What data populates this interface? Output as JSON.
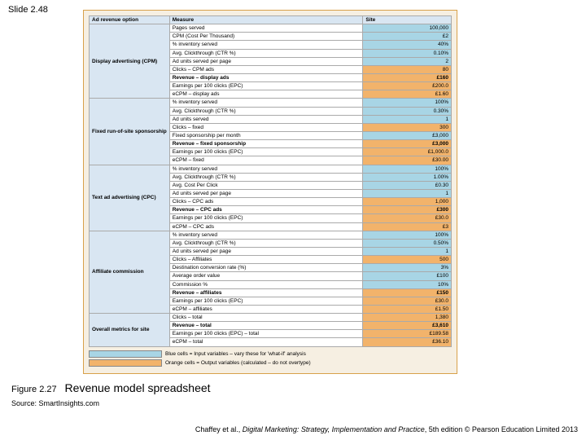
{
  "slide_number": "Slide 2.48",
  "caption": {
    "fig": "Figure 2.27",
    "title": "Revenue model spreadsheet"
  },
  "source": "Source: SmartInsights.com",
  "credit_prefix": "Chaffey et al., ",
  "credit_title": "Digital Marketing: Strategy, Implementation and Practice",
  "credit_suffix": ", 5th edition © Pearson Education Limited 2013",
  "headers": {
    "c1": "Ad revenue option",
    "c2": "Measure",
    "c3": "Site"
  },
  "legend": {
    "blue": "Blue cells = Input variables – vary these for 'what-if' analysis",
    "orange": "Orange cells = Output variables (calculated – do not overtype)"
  },
  "sections": [
    {
      "label": "Display advertising (CPM)",
      "rows": [
        {
          "m": "Pages served",
          "v": "100,000",
          "c": "blue"
        },
        {
          "m": "CPM (Cost Per Thousand)",
          "v": "£2",
          "c": "blue"
        },
        {
          "m": "% inventory served",
          "v": "40%",
          "c": "blue"
        },
        {
          "m": "Avg. Clickthrough (CTR %)",
          "v": "0.10%",
          "c": "blue"
        },
        {
          "m": "Ad units served per page",
          "v": "2",
          "c": "blue"
        },
        {
          "m": "Clicks – CPM ads",
          "v": "80",
          "c": "orange"
        },
        {
          "m": "Revenue – display ads",
          "v": "£160",
          "c": "orange",
          "bold": true
        },
        {
          "m": "Earnings per 100 clicks (EPC)",
          "v": "£200.0",
          "c": "orange"
        },
        {
          "m": "eCPM – display ads",
          "v": "£1.60",
          "c": "orange"
        }
      ]
    },
    {
      "label": "Fixed run-of-site sponsorship",
      "rows": [
        {
          "m": "% inventory served",
          "v": "100%",
          "c": "blue"
        },
        {
          "m": "Avg. Clickthrough (CTR %)",
          "v": "0.30%",
          "c": "blue"
        },
        {
          "m": "Ad units served",
          "v": "1",
          "c": "blue"
        },
        {
          "m": "Clicks – fixed",
          "v": "300",
          "c": "orange"
        },
        {
          "m": "Fixed sponsorship per month",
          "v": "£3,000",
          "c": "blue"
        },
        {
          "m": "Revenue – fixed sponsorship",
          "v": "£3,000",
          "c": "orange",
          "bold": true
        },
        {
          "m": "Earnings per 100 clicks (EPC)",
          "v": "£1,000.0",
          "c": "orange"
        },
        {
          "m": "eCPM – fixed",
          "v": "£30.00",
          "c": "orange"
        }
      ]
    },
    {
      "label": "Text ad advertising (CPC)",
      "rows": [
        {
          "m": "% inventory served",
          "v": "100%",
          "c": "blue"
        },
        {
          "m": "Avg. Clickthrough (CTR %)",
          "v": "1.00%",
          "c": "blue"
        },
        {
          "m": "Avg. Cost Per Click",
          "v": "£0.30",
          "c": "blue"
        },
        {
          "m": "Ad units served per page",
          "v": "1",
          "c": "blue"
        },
        {
          "m": "Clicks – CPC ads",
          "v": "1,000",
          "c": "orange"
        },
        {
          "m": "Revenue – CPC ads",
          "v": "£300",
          "c": "orange",
          "bold": true
        },
        {
          "m": "Earnings per 100 clicks (EPC)",
          "v": "£30.0",
          "c": "orange"
        },
        {
          "m": "eCPM – CPC ads",
          "v": "£3",
          "c": "orange"
        }
      ]
    },
    {
      "label": "Affiliate commission",
      "rows": [
        {
          "m": "% inventory served",
          "v": "100%",
          "c": "blue"
        },
        {
          "m": "Avg. Clickthrough (CTR %)",
          "v": "0.50%",
          "c": "blue"
        },
        {
          "m": "Ad units served per page",
          "v": "1",
          "c": "blue"
        },
        {
          "m": "Clicks – Affiliates",
          "v": "500",
          "c": "orange"
        },
        {
          "m": "Destination conversion rate (%)",
          "v": "3%",
          "c": "blue"
        },
        {
          "m": "Average order value",
          "v": "£100",
          "c": "blue"
        },
        {
          "m": "Commission %",
          "v": "10%",
          "c": "blue"
        },
        {
          "m": "Revenue – affiliates",
          "v": "£150",
          "c": "orange",
          "bold": true
        },
        {
          "m": "Earnings per 100 clicks (EPC)",
          "v": "£30.0",
          "c": "orange"
        },
        {
          "m": "eCPM – affiliates",
          "v": "£1.50",
          "c": "orange"
        }
      ]
    },
    {
      "label": "Overall metrics for site",
      "rows": [
        {
          "m": "Clicks – total",
          "v": "1,380",
          "c": "orange"
        },
        {
          "m": "Revenue – total",
          "v": "£3,610",
          "c": "orange",
          "bold": true
        },
        {
          "m": "Earnings per 100 clicks (EPC) – total",
          "v": "£189.58",
          "c": "orange"
        },
        {
          "m": "eCPM – total",
          "v": "£36.10",
          "c": "orange"
        }
      ]
    }
  ]
}
